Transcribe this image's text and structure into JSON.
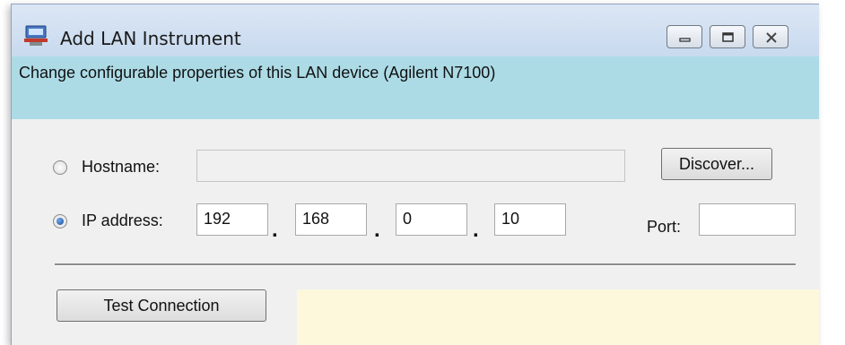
{
  "window": {
    "title": "Add LAN Instrument",
    "description": "Change configurable properties of this LAN device (Agilent N7100)"
  },
  "hostname": {
    "label": "Hostname:",
    "value": "",
    "selected": false
  },
  "ip": {
    "label": "IP address:",
    "octets": [
      "192",
      "168",
      "0",
      "10"
    ],
    "selected": true,
    "separator": "."
  },
  "port": {
    "label": "Port:",
    "value": ""
  },
  "buttons": {
    "discover": "Discover...",
    "test_connection": "Test Connection"
  },
  "colors": {
    "banner": "#acdbe6",
    "status_panel": "#fdf8dc"
  }
}
